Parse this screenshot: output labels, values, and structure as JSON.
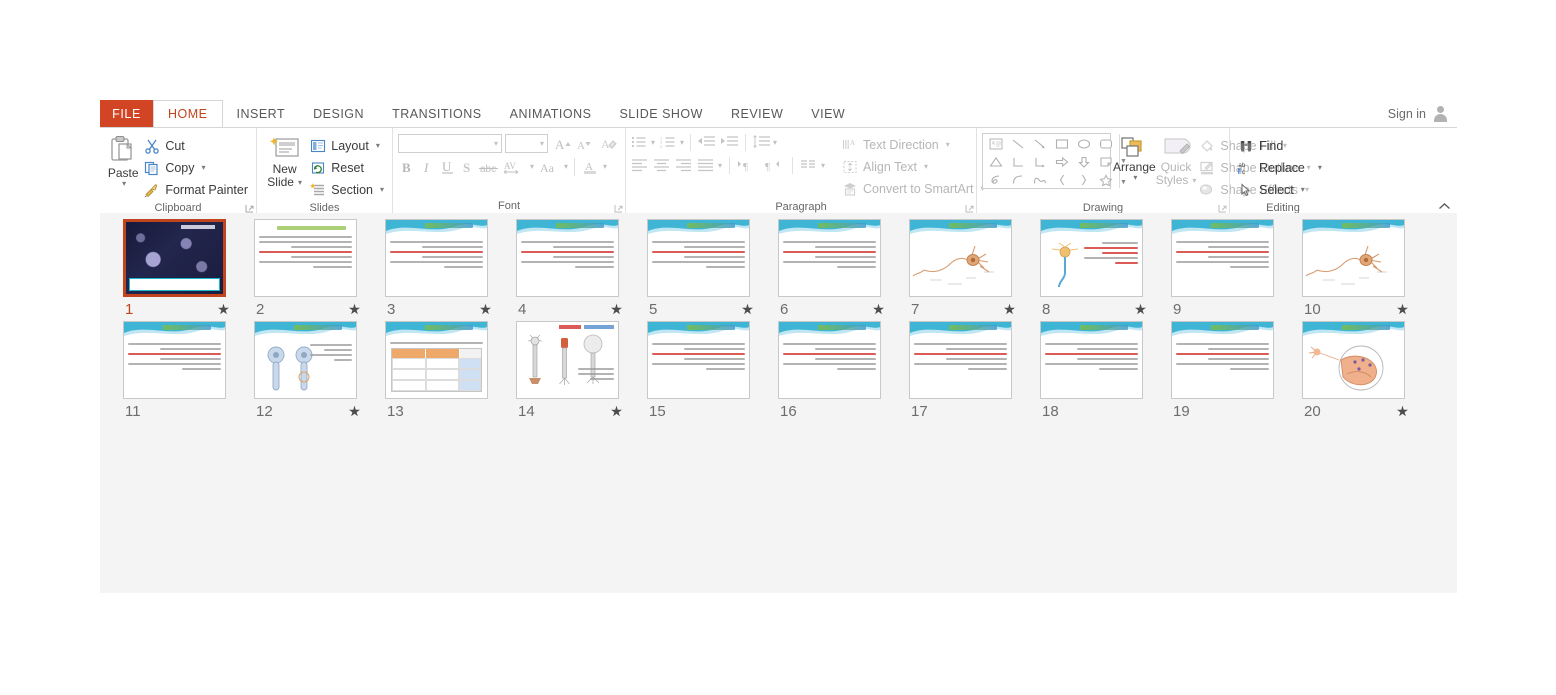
{
  "app": {
    "name": "Microsoft PowerPoint",
    "view": "slide-sorter"
  },
  "tabs": {
    "file_label": "FILE",
    "items": [
      {
        "label": "HOME",
        "active": true
      },
      {
        "label": "INSERT",
        "active": false
      },
      {
        "label": "DESIGN",
        "active": false
      },
      {
        "label": "TRANSITIONS",
        "active": false
      },
      {
        "label": "ANIMATIONS",
        "active": false
      },
      {
        "label": "SLIDE SHOW",
        "active": false
      },
      {
        "label": "REVIEW",
        "active": false
      },
      {
        "label": "VIEW",
        "active": false
      }
    ],
    "signin_label": "Sign in",
    "signin_icon": "person-icon"
  },
  "ribbon": {
    "groups": [
      {
        "label": "Clipboard",
        "has_dialog_launcher": true,
        "paste": {
          "label": "Paste",
          "icon": "clipboard-icon",
          "has_caret": true
        },
        "commands": [
          {
            "label": "Cut",
            "icon": "scissors-icon",
            "has_caret": false
          },
          {
            "label": "Copy",
            "icon": "copy-icon",
            "has_caret": true
          },
          {
            "label": "Format Painter",
            "icon": "paintbrush-icon",
            "has_caret": false
          }
        ]
      },
      {
        "label": "Slides",
        "has_dialog_launcher": false,
        "new_slide": {
          "label_line1": "New",
          "label_line2": "Slide",
          "icon": "new-slide-icon",
          "has_caret": true
        },
        "commands": [
          {
            "label": "Layout",
            "icon": "layout-icon",
            "has_caret": true
          },
          {
            "label": "Reset",
            "icon": "reset-icon",
            "has_caret": false
          },
          {
            "label": "Section",
            "icon": "section-icon",
            "has_caret": true
          }
        ]
      },
      {
        "label": "Font",
        "has_dialog_launcher": true,
        "disabled": true,
        "font_name_value": "",
        "font_size_value": "",
        "row1": [
          {
            "name": "increase-font-size-icon",
            "glyph": "A"
          },
          {
            "name": "decrease-font-size-icon",
            "glyph": "A"
          },
          {
            "name": "clear-formatting-icon",
            "glyph": "eraser"
          }
        ],
        "row2": [
          {
            "name": "bold-icon",
            "glyph": "B"
          },
          {
            "name": "italic-icon",
            "glyph": "I"
          },
          {
            "name": "underline-icon",
            "glyph": "U"
          },
          {
            "name": "text-shadow-icon",
            "glyph": "S"
          },
          {
            "name": "strikethrough-icon",
            "glyph": "abc"
          },
          {
            "name": "character-spacing-icon",
            "glyph": "AV"
          },
          {
            "name": "change-case-icon",
            "glyph": "Aa"
          },
          {
            "name": "font-color-icon",
            "glyph": "A"
          }
        ]
      },
      {
        "label": "Paragraph",
        "has_dialog_launcher": true,
        "disabled": true,
        "row1": [
          {
            "name": "bullets-icon"
          },
          {
            "name": "numbering-icon"
          },
          {
            "name": "decrease-indent-icon"
          },
          {
            "name": "increase-indent-icon"
          },
          {
            "name": "line-spacing-icon"
          }
        ],
        "row2": [
          {
            "name": "align-left-icon"
          },
          {
            "name": "align-center-icon"
          },
          {
            "name": "align-right-icon"
          },
          {
            "name": "justify-icon"
          },
          {
            "name": "ltr-text-direction-icon"
          },
          {
            "name": "rtl-text-direction-icon"
          },
          {
            "name": "columns-icon"
          }
        ],
        "commands": [
          {
            "label": "Text Direction",
            "icon": "text-direction-icon",
            "has_caret": true
          },
          {
            "label": "Align Text",
            "icon": "align-text-icon",
            "has_caret": true
          },
          {
            "label": "Convert to SmartArt",
            "icon": "smartart-icon",
            "has_caret": true
          }
        ]
      },
      {
        "label": "Drawing",
        "has_dialog_launcher": true,
        "shapes_gallery": [
          "text-box-shape",
          "line-shape",
          "arrow-line-shape",
          "rectangle-shape",
          "oval-shape",
          "rounded-rectangle-shape",
          "triangle-shape",
          "elbow-connector-shape",
          "elbow-arrow-shape",
          "right-arrow-shape",
          "down-arrow-shape",
          "folded-corner-shape",
          "scribble-shape",
          "arc-shape",
          "curve-shape",
          "left-brace-shape",
          "right-brace-shape",
          "star-shape"
        ],
        "arrange": {
          "label": "Arrange",
          "icon": "arrange-icon",
          "has_caret": true
        },
        "quick_styles": {
          "label_line1": "Quick",
          "label_line2": "Styles",
          "icon": "quick-styles-icon",
          "has_caret": true
        },
        "commands": [
          {
            "label": "Shape Fill",
            "icon": "shape-fill-icon",
            "has_caret": true
          },
          {
            "label": "Shape Outline",
            "icon": "shape-outline-icon",
            "has_caret": true
          },
          {
            "label": "Shape Effects",
            "icon": "shape-effects-icon",
            "has_caret": true
          }
        ]
      },
      {
        "label": "Editing",
        "has_dialog_launcher": false,
        "commands": [
          {
            "label": "Find",
            "icon": "binoculars-icon",
            "has_caret": false
          },
          {
            "label": "Replace",
            "icon": "replace-icon",
            "has_caret": true
          },
          {
            "label": "Select",
            "icon": "select-pointer-icon",
            "has_caret": true
          }
        ]
      }
    ],
    "collapse_icon": "chevron-up-icon"
  },
  "slides": [
    {
      "number": "1",
      "selected": true,
      "has_animation_star": true,
      "style": "title-image",
      "lang": "fa"
    },
    {
      "number": "2",
      "selected": false,
      "has_animation_star": true,
      "style": "plain-text",
      "lang": "fa"
    },
    {
      "number": "3",
      "selected": false,
      "has_animation_star": true,
      "style": "wave-text",
      "lang": "fa"
    },
    {
      "number": "4",
      "selected": false,
      "has_animation_star": true,
      "style": "wave-text",
      "lang": "fa"
    },
    {
      "number": "5",
      "selected": false,
      "has_animation_star": true,
      "style": "wave-text",
      "lang": "fa"
    },
    {
      "number": "6",
      "selected": false,
      "has_animation_star": true,
      "style": "wave-text",
      "lang": "fa"
    },
    {
      "number": "7",
      "selected": false,
      "has_animation_star": true,
      "style": "wave-neuron",
      "lang": "fa"
    },
    {
      "number": "8",
      "selected": false,
      "has_animation_star": true,
      "style": "wave-neuron-text",
      "lang": "fa"
    },
    {
      "number": "9",
      "selected": false,
      "has_animation_star": false,
      "style": "wave-text",
      "lang": "fa"
    },
    {
      "number": "10",
      "selected": false,
      "has_animation_star": true,
      "style": "wave-neuron",
      "lang": "fa"
    },
    {
      "number": "11",
      "selected": false,
      "has_animation_star": false,
      "style": "wave-text",
      "lang": "fa"
    },
    {
      "number": "12",
      "selected": false,
      "has_animation_star": true,
      "style": "wave-pair",
      "lang": "fa"
    },
    {
      "number": "13",
      "selected": false,
      "has_animation_star": false,
      "style": "wave-table",
      "lang": "fa"
    },
    {
      "number": "14",
      "selected": false,
      "has_animation_star": true,
      "style": "diagram",
      "lang": "fa"
    },
    {
      "number": "15",
      "selected": false,
      "has_animation_star": false,
      "style": "wave-text",
      "lang": "fa"
    },
    {
      "number": "16",
      "selected": false,
      "has_animation_star": false,
      "style": "wave-text",
      "lang": "fa"
    },
    {
      "number": "17",
      "selected": false,
      "has_animation_star": false,
      "style": "wave-text",
      "lang": "fa"
    },
    {
      "number": "18",
      "selected": false,
      "has_animation_star": false,
      "style": "wave-text",
      "lang": "fa"
    },
    {
      "number": "19",
      "selected": false,
      "has_animation_star": false,
      "style": "wave-text",
      "lang": "fa"
    },
    {
      "number": "20",
      "selected": false,
      "has_animation_star": true,
      "style": "wave-synapse",
      "lang": "fa"
    }
  ],
  "colors": {
    "file_tab": "#d14524",
    "active_tab_text": "#c0451f",
    "selection_border": "#c0451f",
    "pane_background": "#f4f4f4",
    "ribbon_text": "#3b3b3b",
    "disabled_text": "#b6b6b6",
    "group_label": "#666666",
    "slide_wave_teal": "#2aa9c6",
    "slide_accent_red": "#d2322d"
  }
}
